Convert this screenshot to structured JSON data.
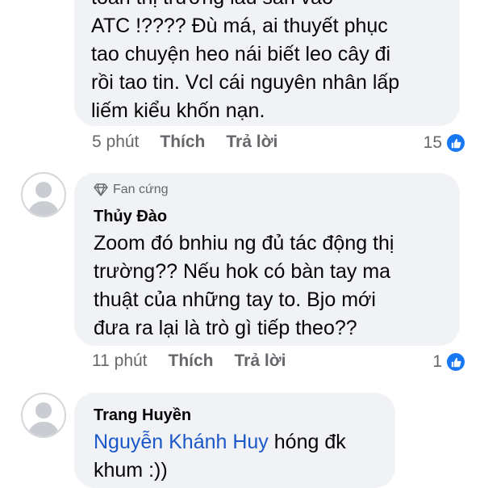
{
  "comment1": {
    "lines": [
      "toàn thị trường lấu sàn vào",
      "ATC  !???? Đù má, ai thuyết phục",
      "tao chuyện heo nái biết leo cây đi",
      "rồi tao tin. Vcl cái nguyên nhân lấp",
      "liếm kiểu khốn nạn."
    ],
    "time": "5 phút",
    "like_label": "Thích",
    "reply_label": "Trả lời",
    "reaction_count": "15"
  },
  "comment2": {
    "badge_label": "Fan cứng",
    "author": "Thủy Đào",
    "lines": [
      "Zoom đó bnhiu ng đủ tác động thị",
      "trường?? Nếu hok có bàn tay ma",
      "thuật của những tay to. Bjo mới",
      "đưa ra lại là trò gì tiếp theo??"
    ],
    "time": "11 phút",
    "like_label": "Thích",
    "reply_label": "Trả lời",
    "reaction_count": "1"
  },
  "comment3": {
    "author": "Trang Huyền",
    "mention": "Nguyễn Khánh Huy",
    "text_after_mention": " hóng đk",
    "line2": "khum :))"
  },
  "colors": {
    "bubble": "#f0f2f5",
    "like_blue": "#1877f2",
    "mention": "#1a57c9",
    "meta_gray": "#65676b"
  }
}
